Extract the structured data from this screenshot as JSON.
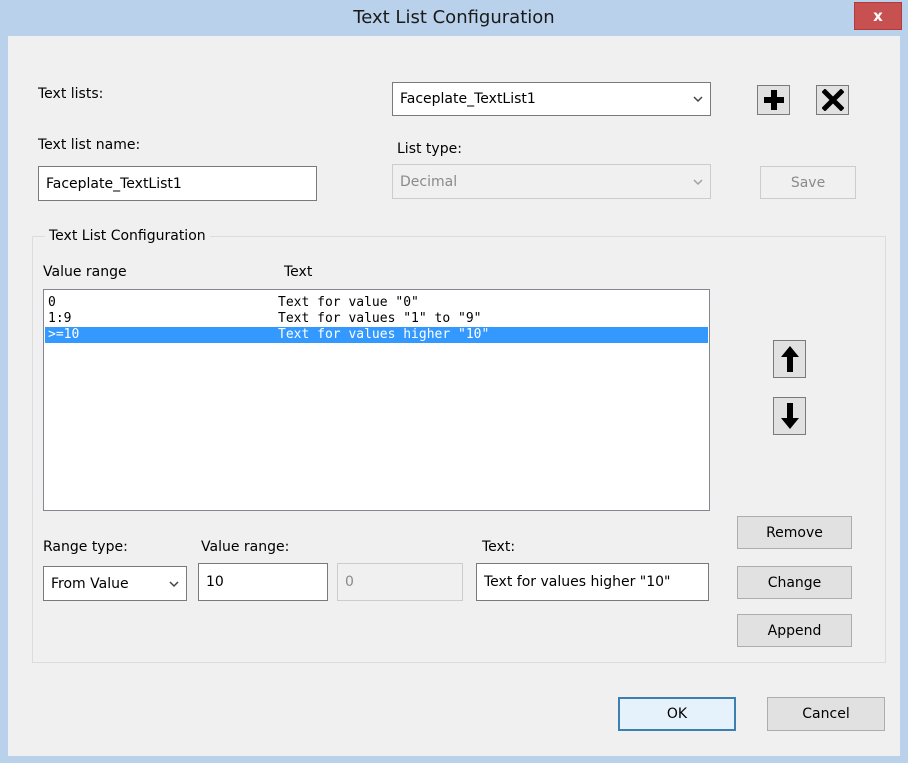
{
  "window": {
    "title": "Text List Configuration",
    "close_label": "x"
  },
  "top": {
    "text_lists_label": "Text lists:",
    "text_lists_value": "Faceplate_TextList1",
    "text_list_name_label": "Text list name:",
    "text_list_name_value": "Faceplate_TextList1",
    "list_type_label": "List type:",
    "list_type_value": "Decimal",
    "save_label": "Save"
  },
  "group": {
    "title": "Text List Configuration",
    "col_value_range": "Value range",
    "col_text": "Text",
    "rows": [
      {
        "range": "0",
        "text": "Text for value \"0\"",
        "selected": false
      },
      {
        "range": "1:9",
        "text": "Text for values \"1\" to \"9\"",
        "selected": false
      },
      {
        "range": ">=10",
        "text": "Text for values higher \"10\"",
        "selected": true
      }
    ]
  },
  "editor": {
    "range_type_label": "Range type:",
    "range_type_value": "From Value",
    "value_range_label": "Value range:",
    "value_from": "10",
    "value_to": "0",
    "text_label": "Text:",
    "text_value": "Text for values higher \"10\""
  },
  "buttons": {
    "remove": "Remove",
    "change": "Change",
    "append": "Append",
    "ok": "OK",
    "cancel": "Cancel"
  },
  "icons": {
    "add": "plus-icon",
    "delete": "x-icon",
    "move_up": "arrow-up-icon",
    "move_down": "arrow-down-icon"
  }
}
